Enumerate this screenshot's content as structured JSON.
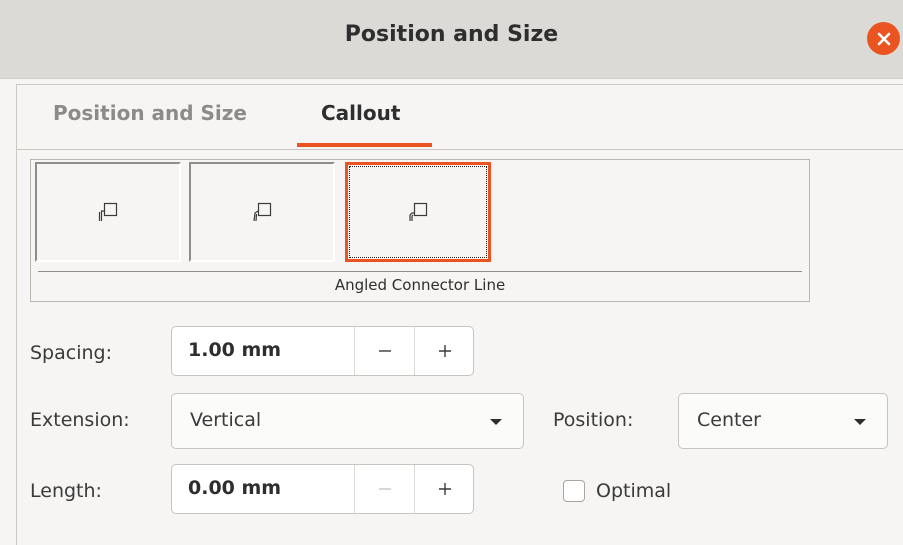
{
  "window": {
    "title": "Position and Size"
  },
  "tabs": [
    {
      "label": "Position and Size",
      "active": false
    },
    {
      "label": "Callout",
      "active": true
    }
  ],
  "callout_styles": {
    "items": [
      {
        "icon": "straight-line-callout-icon"
      },
      {
        "icon": "angled-line-callout-icon"
      },
      {
        "icon": "angled-connector-callout-icon",
        "selected": true
      }
    ],
    "selected_label": "Angled Connector Line"
  },
  "spacing": {
    "label": "Spacing:",
    "value": "1.00 mm"
  },
  "extension": {
    "label": "Extension:",
    "value": "Vertical"
  },
  "position": {
    "label": "Position:",
    "value": "Center"
  },
  "length": {
    "label": "Length:",
    "value": "0.00 mm"
  },
  "optimal": {
    "label": "Optimal",
    "checked": false
  },
  "colors": {
    "accent": "#e95420"
  }
}
